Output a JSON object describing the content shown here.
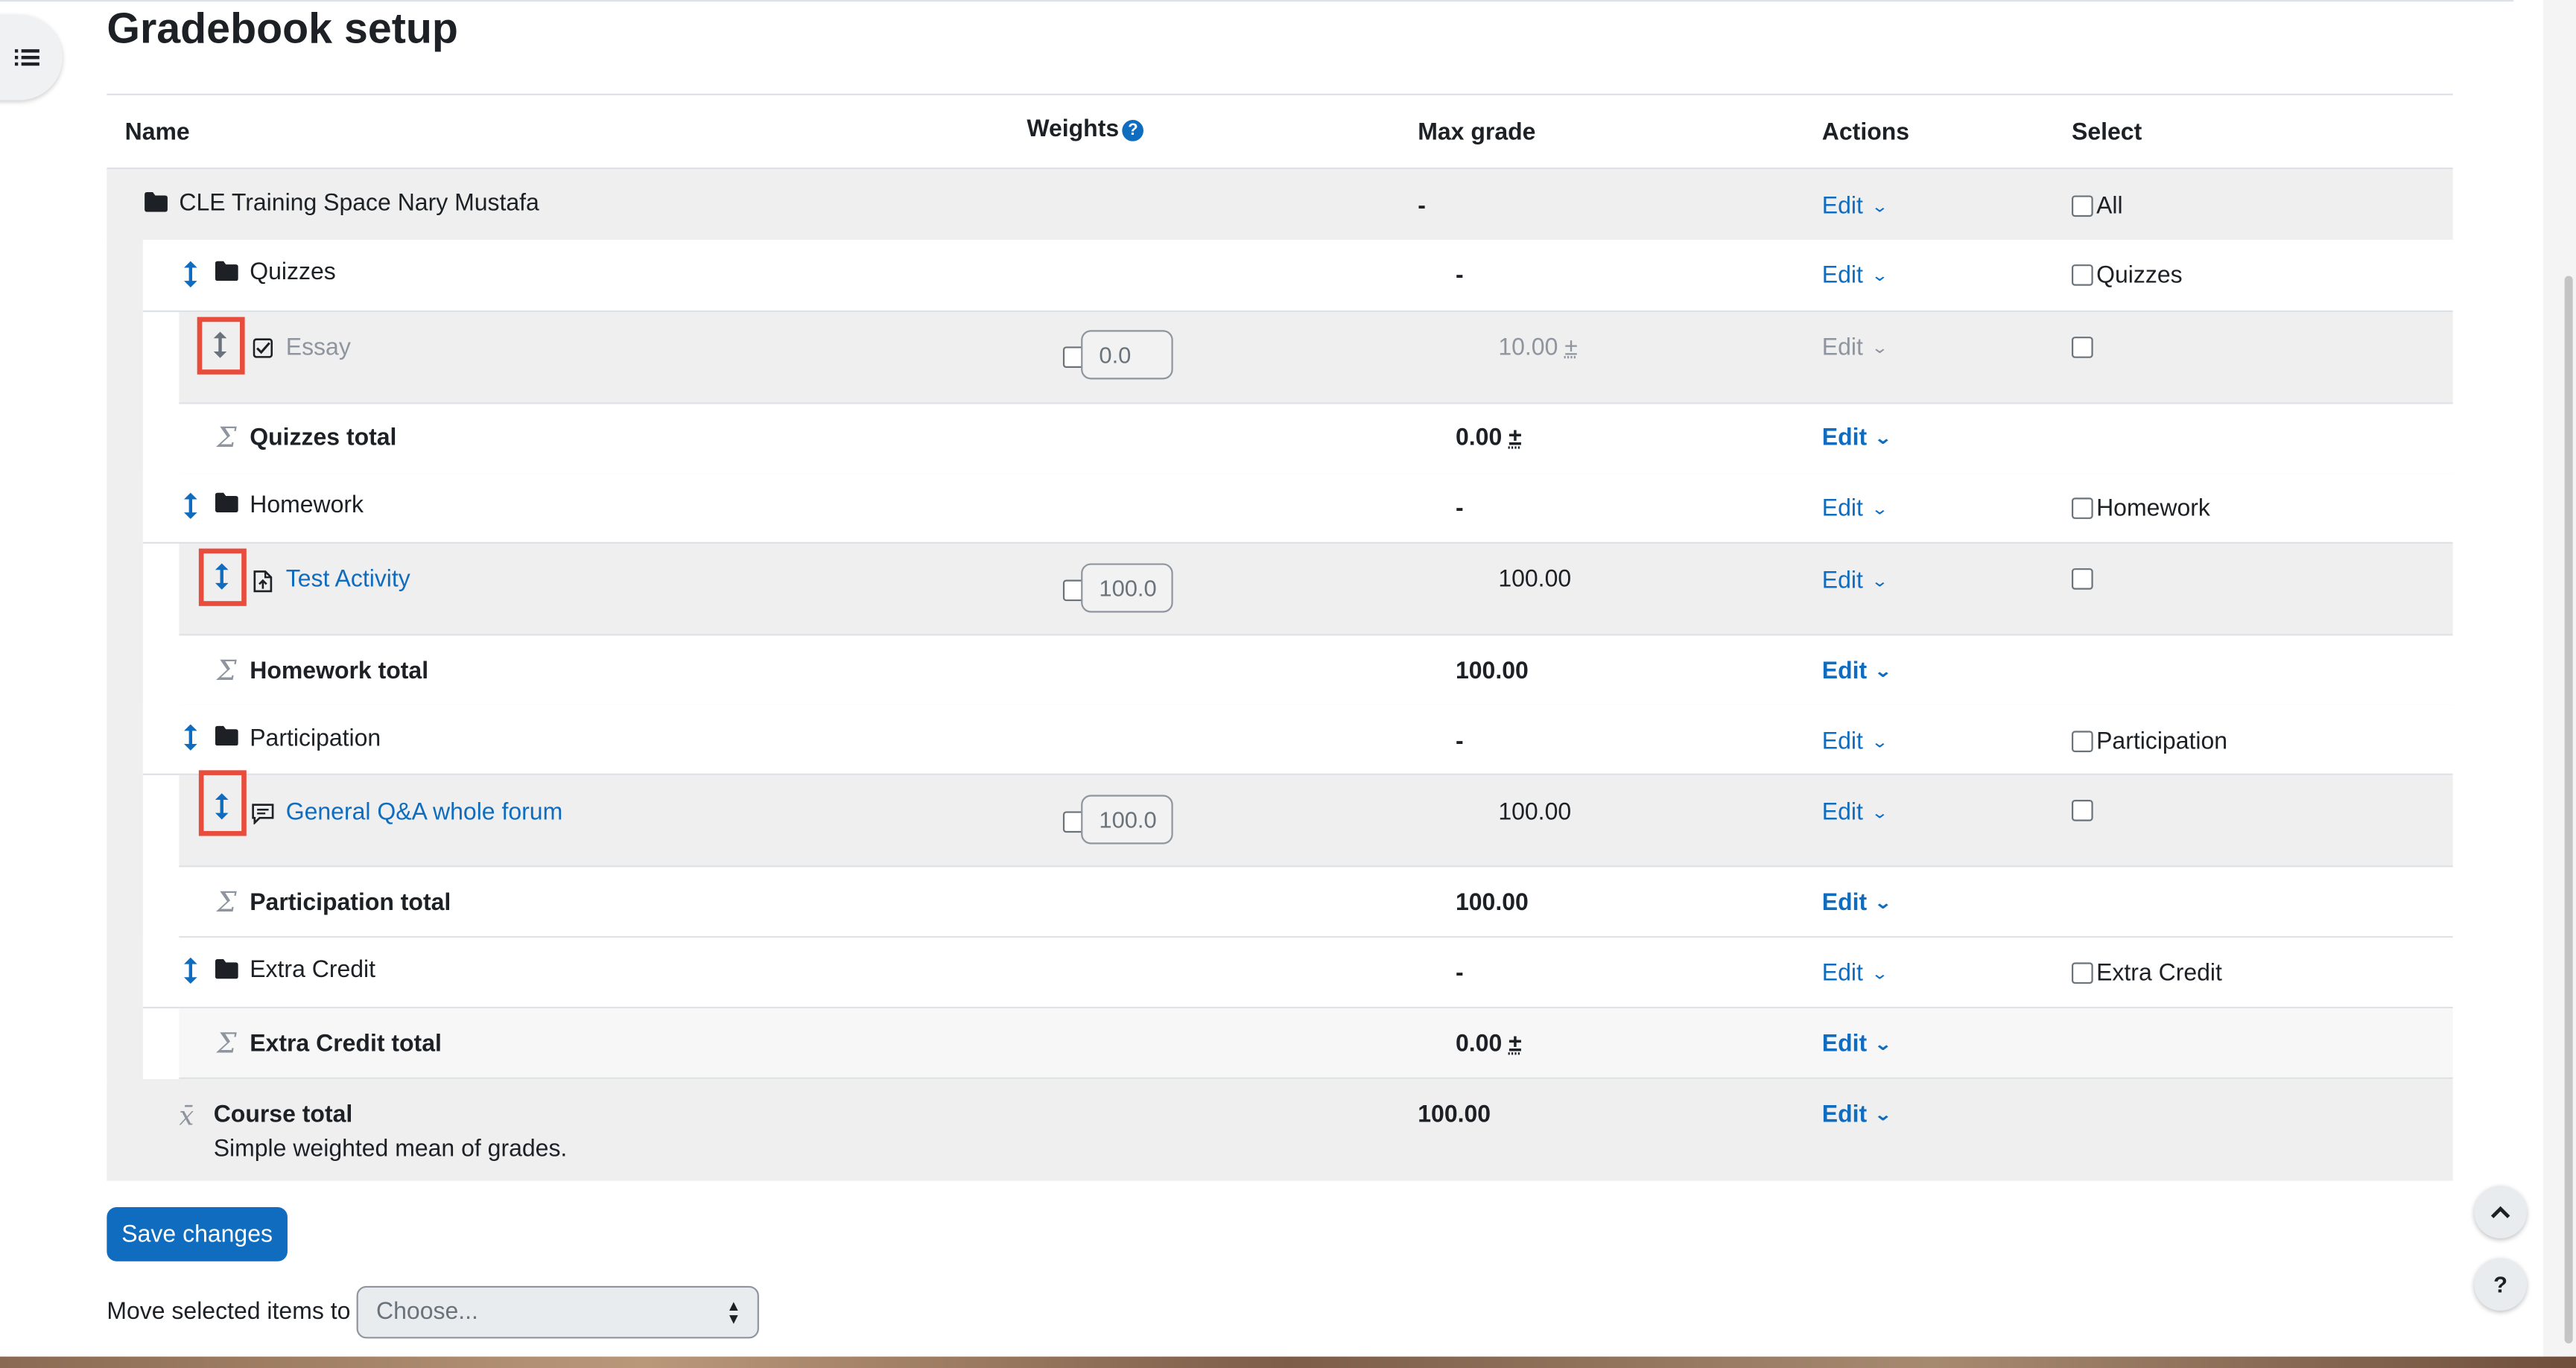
{
  "page": {
    "title": "Gradebook setup"
  },
  "table": {
    "headers": {
      "name": "Name",
      "weights": "Weights",
      "help": "?",
      "max_grade": "Max grade",
      "actions": "Actions",
      "select": "Select"
    },
    "course": {
      "name": "CLE Training Space Nary Mustafa",
      "max": "-",
      "edit": "Edit",
      "select_label": "All"
    },
    "quizzes": {
      "category": {
        "name": "Quizzes",
        "max": "-",
        "edit": "Edit",
        "select_label": "Quizzes"
      },
      "item": {
        "name": "Essay",
        "weight": "0.0",
        "max": "10.00",
        "plusminus": "±",
        "edit": "Edit"
      },
      "total": {
        "name": "Quizzes total",
        "max": "0.00",
        "plusminus": "±",
        "edit": "Edit"
      }
    },
    "homework": {
      "category": {
        "name": "Homework",
        "max": "-",
        "edit": "Edit",
        "select_label": "Homework"
      },
      "item": {
        "name": "Test Activity",
        "weight": "100.0",
        "max": "100.00",
        "edit": "Edit"
      },
      "total": {
        "name": "Homework total",
        "max": "100.00",
        "edit": "Edit"
      }
    },
    "participation": {
      "category": {
        "name": "Participation",
        "max": "-",
        "edit": "Edit",
        "select_label": "Participation"
      },
      "item": {
        "name": "General Q&A whole forum",
        "weight": "100.0",
        "max": "100.00",
        "edit": "Edit"
      },
      "total": {
        "name": "Participation total",
        "max": "100.00",
        "edit": "Edit"
      }
    },
    "extra_credit": {
      "category": {
        "name": "Extra Credit",
        "max": "-",
        "edit": "Edit",
        "select_label": "Extra Credit"
      },
      "total": {
        "name": "Extra Credit total",
        "max": "0.00",
        "plusminus": "±",
        "edit": "Edit"
      }
    },
    "course_total": {
      "name": "Course total",
      "description": "Simple weighted mean of grades.",
      "max": "100.00",
      "edit": "Edit"
    }
  },
  "footer": {
    "save_label": "Save changes",
    "move_label": "Move selected items to",
    "move_placeholder": "Choose...",
    "scroll_top": "^",
    "help": "?"
  },
  "colors": {
    "accent": "#0f6cbf",
    "highlight": "#e74c3c",
    "muted": "#8f959e"
  },
  "icons": [
    "drawer-toggle-icon",
    "folder-icon",
    "move-icon",
    "quiz-icon",
    "assignment-icon",
    "forum-icon",
    "sigma-icon",
    "calculator-icon",
    "chevron-down-icon"
  ]
}
